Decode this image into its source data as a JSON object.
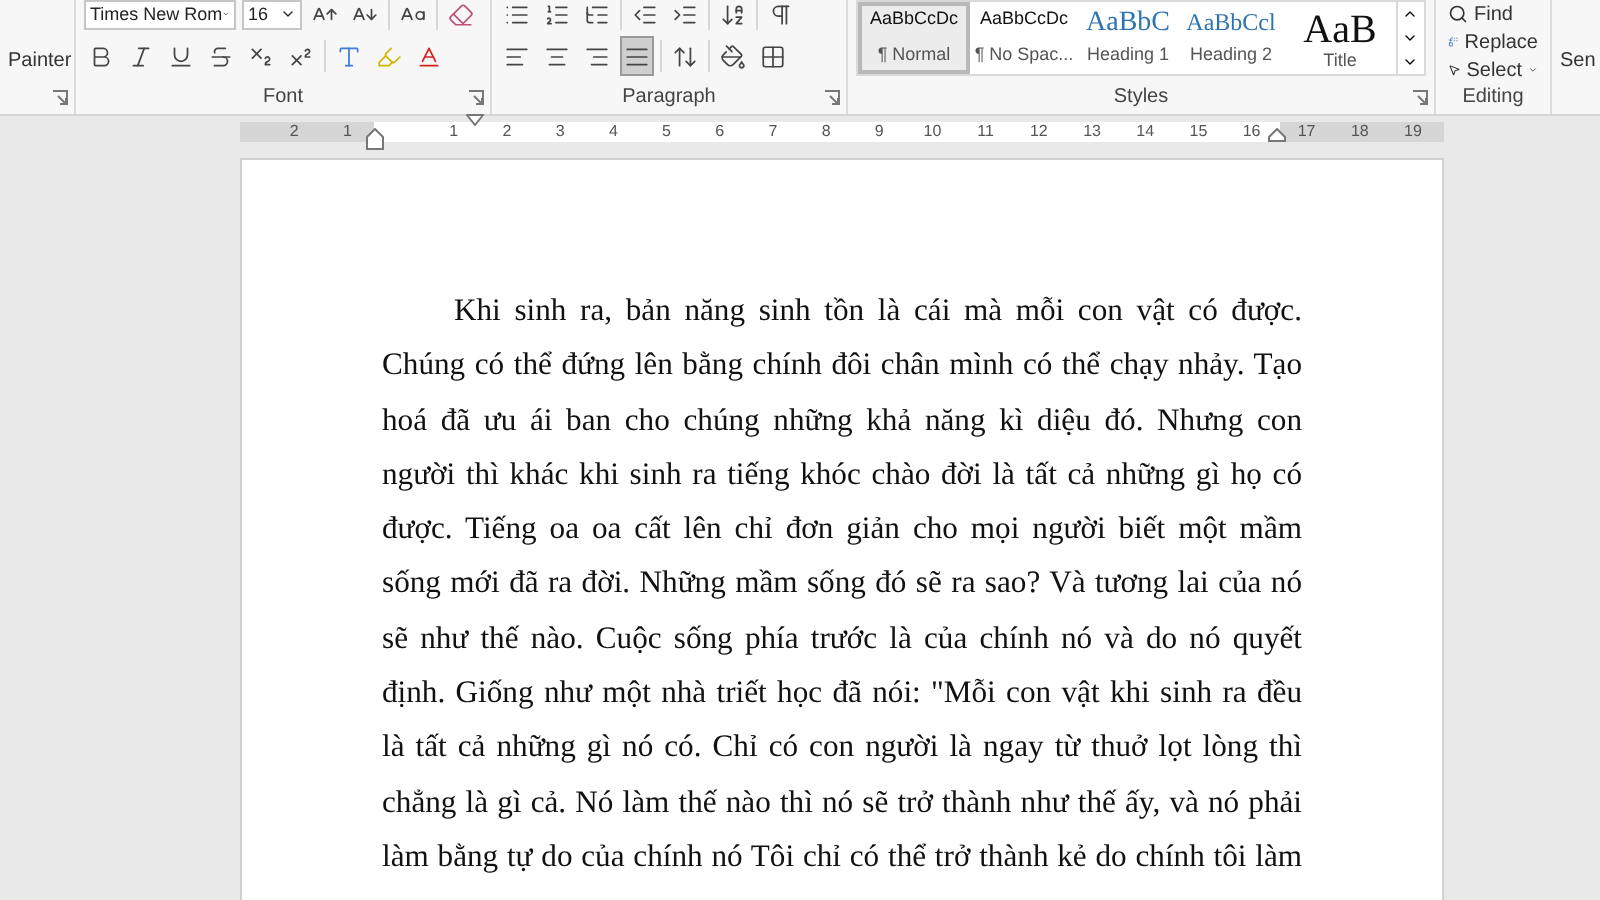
{
  "ribbon": {
    "clipboard": {
      "format_painter_label": "Painter"
    },
    "font": {
      "font_name": "Times New Rom",
      "font_size": "16",
      "group_label": "Font"
    },
    "paragraph": {
      "alignment_buttons": [
        {
          "selected": false
        },
        {
          "selected": false
        },
        {
          "selected": false
        },
        {
          "selected": true
        }
      ],
      "group_label": "Paragraph"
    },
    "styles": {
      "items": [
        {
          "preview": "AaBbCcDc",
          "name": "¶ Normal",
          "kind": "body",
          "selected": true
        },
        {
          "preview": "AaBbCcDc",
          "name": "¶ No Spac...",
          "kind": "body",
          "selected": false
        },
        {
          "preview": "AaBbC",
          "name": "Heading 1",
          "kind": "heading1",
          "selected": false
        },
        {
          "preview": "AaBbCcl",
          "name": "Heading 2",
          "kind": "heading2",
          "selected": false
        },
        {
          "preview": "AaB",
          "name": "Title",
          "kind": "title",
          "selected": false
        }
      ],
      "group_label": "Styles"
    },
    "editing": {
      "find": "Find",
      "replace": "Replace",
      "select": "Select",
      "group_label": "Editing"
    },
    "next_group_label": "Sen"
  },
  "ruler": {
    "left_margin_labels": [
      "2",
      "1"
    ],
    "text_labels": [
      "1",
      "2",
      "3",
      "4",
      "5",
      "6",
      "7",
      "8",
      "9",
      "10",
      "11",
      "12",
      "13",
      "14",
      "15",
      "16"
    ],
    "right_margin_labels": [
      "17",
      "18",
      "19"
    ]
  },
  "document": {
    "lines": [
      "Khi sinh ra, bản năng sinh tồn là cái mà mỗi con vật có được.",
      "Chúng có thể đứng lên bằng chính đôi chân mình có thể chạy nhảy. Tạo",
      "hoá đã ưu ái ban cho chúng những khả năng kì diệu đó. Nhưng con",
      "người thì khác khi sinh ra tiếng khóc chào đời là tất cả những gì họ có",
      "được. Tiếng oa oa cất lên chỉ đơn giản cho mọi người biết một mầm",
      "sống mới đã ra đời. Những mầm sống đó sẽ ra sao? Và tương lai của nó",
      "sẽ như thế nào. Cuộc sống phía trước là của chính nó và do nó quyết",
      "định. Giống như một nhà triết học đã nói: \"Mỗi con vật khi sinh ra đều",
      "là tất cả những gì nó có. Chỉ có con người là ngay từ thuở lọt lòng thì",
      "chẳng là gì cả. Nó làm thế nào thì nó sẽ trở thành như thế ấy, và nó phải",
      "làm bằng tự do của chính nó Tôi chỉ có thể trở thành kẻ do chính tôi làm"
    ]
  }
}
